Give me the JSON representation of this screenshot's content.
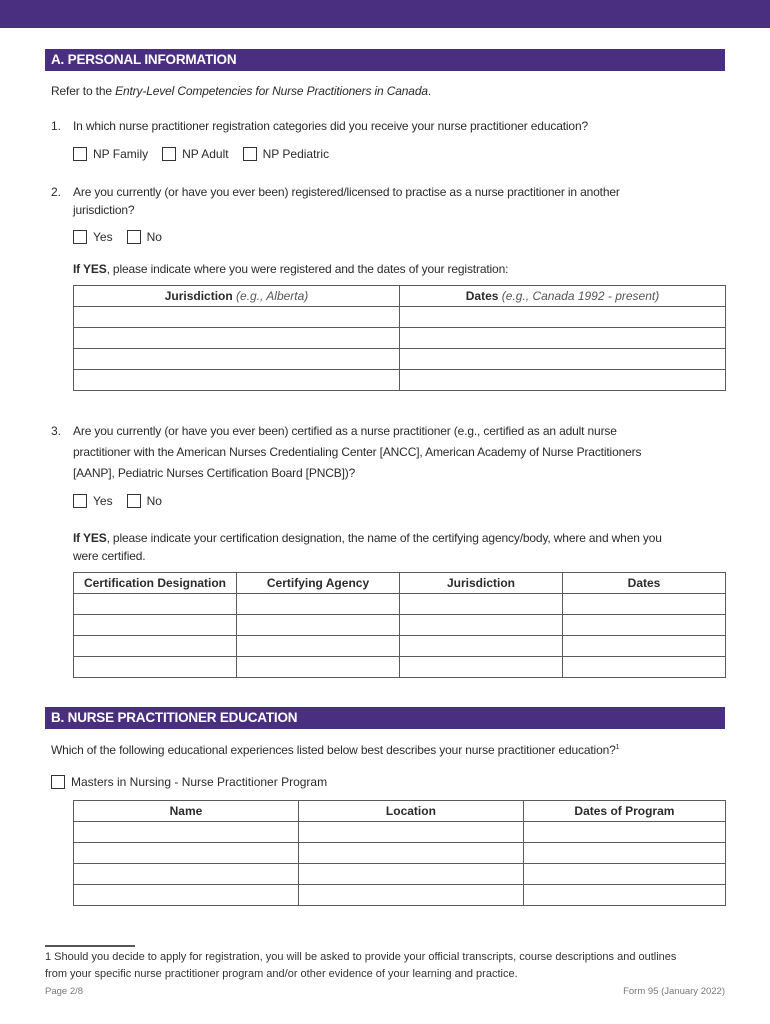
{
  "colors": {
    "brand_purple": "#4a2e80"
  },
  "section_a": {
    "title": "A. PERSONAL INFORMATION",
    "intro_prefix": "Refer to the ",
    "intro_italic": "Entry-Level Competencies for Nurse Practitioners in Canada",
    "intro_suffix": ".",
    "q1": {
      "num": "1.",
      "text": "In which nurse practitioner registration categories did you receive your nurse practitioner education?",
      "options": [
        "NP Family",
        "NP Adult",
        "NP Pediatric"
      ]
    },
    "q2": {
      "num": "2.",
      "text_line1": "Are you currently (or have you ever been) registered/licensed to practise as a nurse practitioner in another",
      "text_line2": "jurisdiction?",
      "options": [
        "Yes",
        "No"
      ],
      "followup_bold": "If YES",
      "followup_rest": ", please indicate where you were registered and the dates of your registration:",
      "table": {
        "headers": [
          {
            "bold": "Jurisdiction",
            "italic": " (e.g., Alberta)"
          },
          {
            "bold": "Dates",
            "italic": " (e.g., Canada 1992 - present)"
          }
        ],
        "row_count": 4
      }
    },
    "q3": {
      "num": "3.",
      "text_line1": "Are you currently (or have you ever been) certified as a nurse practitioner (e.g., certified as an adult nurse",
      "text_line2": "practitioner with the American Nurses Credentialing Center [ANCC], American Academy of Nurse Practitioners",
      "text_line3": "[AANP], Pediatric Nurses Certification Board [PNCB])?",
      "options": [
        "Yes",
        "No"
      ],
      "followup_bold": "If YES",
      "followup_rest_line1": ", please indicate your certification designation, the name of the certifying agency/body, where and when you",
      "followup_line2": "were certified.",
      "table": {
        "headers": [
          "Certification Designation",
          "Certifying Agency",
          "Jurisdiction",
          "Dates"
        ],
        "row_count": 4
      }
    }
  },
  "section_b": {
    "title": "B. NURSE PRACTITIONER EDUCATION",
    "question": "Which of the following educational experiences listed below best describes your nurse practitioner education?",
    "question_sup": "1",
    "option": "Masters in Nursing - Nurse Practitioner Program",
    "table": {
      "headers": [
        "Name",
        "Location",
        "Dates of Program"
      ],
      "row_count": 4
    }
  },
  "footnote": {
    "line1": "1  Should you decide to apply for registration, you will be asked to provide your official transcripts, course descriptions and outlines",
    "line2": "from your specific nurse practitioner program and/or other evidence of your learning and practice."
  },
  "page_footer": {
    "page": "Page 2/8",
    "form": "Form 95 (January 2022)"
  }
}
